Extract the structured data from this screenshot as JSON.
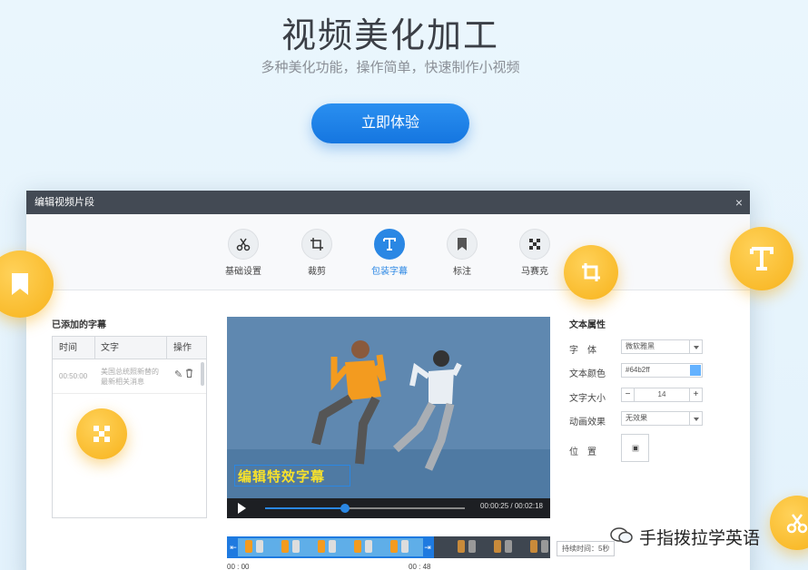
{
  "hero": {
    "title": "视频美化加工",
    "subtitle": "多种美化功能，操作简单，快速制作小视频",
    "cta": "立即体验"
  },
  "editor": {
    "title": "编辑视频片段",
    "close": "×",
    "tools": [
      {
        "label": "基础设置",
        "icon": "scissors-icon"
      },
      {
        "label": "裁剪",
        "icon": "crop-icon"
      },
      {
        "label": "包装字幕",
        "icon": "text-icon",
        "active": true
      },
      {
        "label": "标注",
        "icon": "bookmark-icon"
      },
      {
        "label": "马赛克",
        "icon": "mosaic-icon"
      }
    ],
    "subtitles_panel": {
      "title": "已添加的字幕",
      "columns": [
        "时间",
        "文字",
        "操作"
      ],
      "rows": [
        {
          "time": "00:50:00",
          "text": "美国总统照新替的最新相关消息"
        }
      ]
    },
    "video": {
      "overlay_text": "编辑特效字幕",
      "time": "00:00:25 / 00:02:18",
      "progress": 0.4
    },
    "properties": {
      "title": "文本属性",
      "font_label": "字　体",
      "font_value": "微软雅黑",
      "color_label": "文本颜色",
      "color_value": "#64b2ff",
      "size_label": "文字大小",
      "size_value": "14",
      "size_minus": "−",
      "size_plus": "+",
      "anim_label": "动画效果",
      "anim_value": "无效果",
      "position_label": "位　置"
    },
    "timeline": {
      "start": "00 : 00",
      "mid": "00 : 48",
      "duration": "持续时间：5秒"
    }
  },
  "watermark": "手指拨拉学英语",
  "colors": {
    "accent": "#2a87e4",
    "badge": "#f7b21a",
    "titlebar": "#434a54"
  }
}
